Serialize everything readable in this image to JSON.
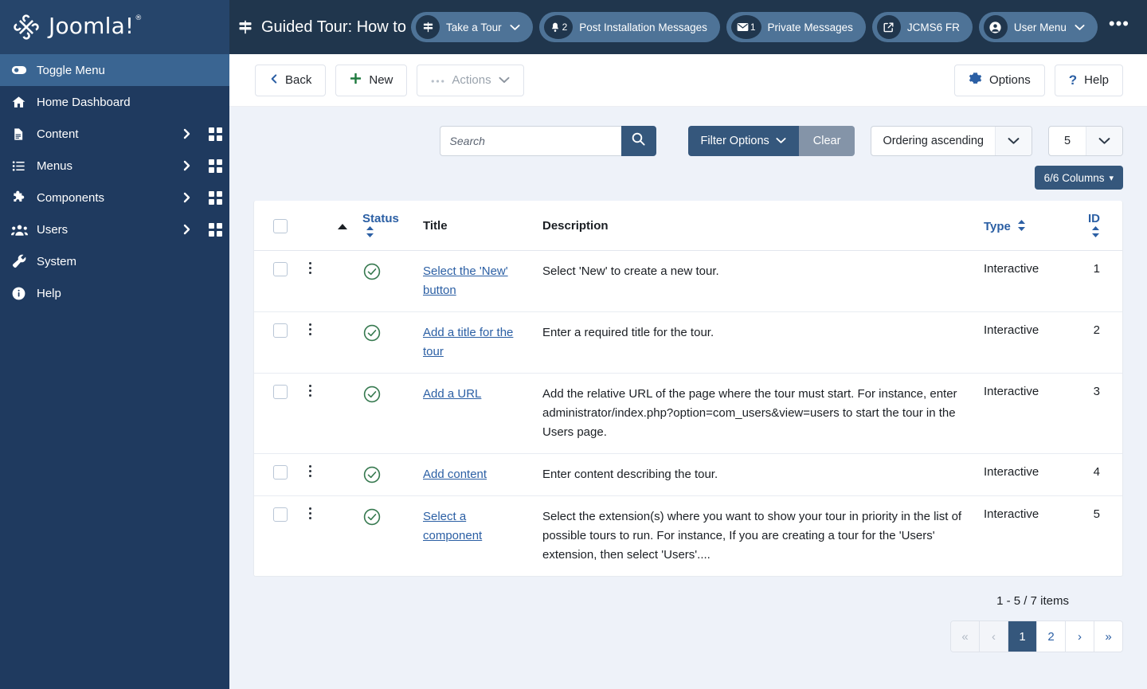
{
  "brand": {
    "name": "Joomla!",
    "trademark": "®"
  },
  "sidebar": {
    "items": [
      {
        "label": "Toggle Menu",
        "icon": "toggle-icon",
        "active": true,
        "caret": false,
        "grid": false
      },
      {
        "label": "Home Dashboard",
        "icon": "home-icon",
        "active": false,
        "caret": false,
        "grid": false
      },
      {
        "label": "Content",
        "icon": "document-icon",
        "active": false,
        "caret": true,
        "grid": true
      },
      {
        "label": "Menus",
        "icon": "list-icon",
        "active": false,
        "caret": true,
        "grid": true
      },
      {
        "label": "Components",
        "icon": "puzzle-icon",
        "active": false,
        "caret": true,
        "grid": true
      },
      {
        "label": "Users",
        "icon": "users-icon",
        "active": false,
        "caret": true,
        "grid": true
      },
      {
        "label": "System",
        "icon": "wrench-icon",
        "active": false,
        "caret": false,
        "grid": false
      },
      {
        "label": "Help",
        "icon": "info-icon",
        "active": false,
        "caret": false,
        "grid": false
      }
    ]
  },
  "header": {
    "title": "Guided Tour: How to create a g",
    "title_icon": "signpost-icon",
    "pills": [
      {
        "label": "Take a Tour",
        "icon": "signpost-icon",
        "badge": "",
        "chevron": true
      },
      {
        "label": "Post Installation Messages",
        "icon": "bell-icon",
        "badge": "2",
        "chevron": false
      },
      {
        "label": "Private Messages",
        "icon": "envelope-icon",
        "badge": "1",
        "chevron": false
      },
      {
        "label": "JCMS6 FR",
        "icon": "external-link-icon",
        "badge": "",
        "chevron": false
      },
      {
        "label": "User Menu",
        "icon": "user-circle-icon",
        "badge": "",
        "chevron": true
      }
    ],
    "overflow_label": "•••"
  },
  "toolbar": {
    "back_label": "Back",
    "new_label": "New",
    "actions_label": "Actions",
    "options_label": "Options",
    "help_label": "Help"
  },
  "filters": {
    "search_placeholder": "Search",
    "search_value": "",
    "filter_options_label": "Filter Options",
    "clear_label": "Clear",
    "ordering_value": "Ordering ascending",
    "limit_value": "5",
    "columns_label": "6/6 Columns"
  },
  "table": {
    "headers": {
      "checkbox": "",
      "actions": "",
      "ordering": "",
      "status": "Status",
      "title": "Title",
      "description": "Description",
      "type": "Type",
      "id": "ID"
    },
    "rows": [
      {
        "title": "Select the 'New' button",
        "description": "Select 'New' to create a new tour.",
        "type": "Interactive",
        "id": "1",
        "status": "published"
      },
      {
        "title": "Add a title for the tour",
        "description": "Enter a required title for the tour.",
        "type": "Interactive",
        "id": "2",
        "status": "published"
      },
      {
        "title": "Add a URL",
        "description": "Add the relative URL of the page where the tour must start. For instance, enter administrator/index.php?option=com_users&view=users to start the tour in the Users page.",
        "type": "Interactive",
        "id": "3",
        "status": "published"
      },
      {
        "title": "Add content",
        "description": "Enter content describing the tour.",
        "type": "Interactive",
        "id": "4",
        "status": "published"
      },
      {
        "title": "Select a component",
        "description": "Select the extension(s) where you want to show your tour in priority in the list of possible tours to run. For instance, If you are creating a tour for the 'Users' extension, then select 'Users'....",
        "type": "Interactive",
        "id": "5",
        "status": "published"
      }
    ]
  },
  "pagination": {
    "count_label": "1 - 5 / 7 items",
    "first": "«",
    "prev": "‹",
    "pages": [
      "1",
      "2"
    ],
    "current": "1",
    "next": "›",
    "last": "»"
  },
  "colors": {
    "sidebar_bg": "#1f3a5f",
    "topbar_bg": "#20364d",
    "accent_blue": "#35577c",
    "link_blue": "#2b5fa4",
    "status_green": "#36794f",
    "page_bg": "#eef2f9"
  }
}
